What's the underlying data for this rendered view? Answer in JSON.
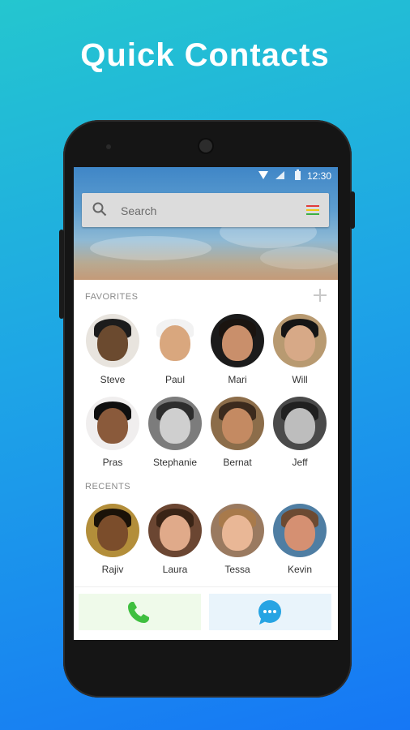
{
  "headline": "Quick Contacts",
  "status": {
    "time": "12:30"
  },
  "search": {
    "placeholder": "Search"
  },
  "favorites": {
    "label": "FAVORITES",
    "contacts": [
      {
        "name": "Steve",
        "skin": "#6b4a2f",
        "hair": "#1c1c1c",
        "bg": "#e8e4de"
      },
      {
        "name": "Paul",
        "skin": "#d9a77e",
        "hair": "#f2f2f2",
        "bg": "#ffffff"
      },
      {
        "name": "Mari",
        "skin": "#c98f6b",
        "hair": "#1a1410",
        "bg": "#1b1b1b"
      },
      {
        "name": "Will",
        "skin": "#d7a987",
        "hair": "#151515",
        "bg": "#b89a71"
      },
      {
        "name": "Pras",
        "skin": "#8a5a3b",
        "hair": "#0f0f0f",
        "bg": "#f0eeee"
      },
      {
        "name": "Stephanie",
        "skin": "#cfcfcf",
        "hair": "#2d2d2d",
        "bg": "#7c7c7c"
      },
      {
        "name": "Bernat",
        "skin": "#c48a62",
        "hair": "#3b2a1d",
        "bg": "#8c6d4a"
      },
      {
        "name": "Jeff",
        "skin": "#bdbdbd",
        "hair": "#202020",
        "bg": "#4a4a4a"
      }
    ]
  },
  "recents": {
    "label": "RECENTS",
    "contacts": [
      {
        "name": "Rajiv",
        "skin": "#7b4d2b",
        "hair": "#1a1208",
        "bg": "#b38e3a"
      },
      {
        "name": "Laura",
        "skin": "#e0aa8a",
        "hair": "#3a2416",
        "bg": "#6b4632"
      },
      {
        "name": "Tessa",
        "skin": "#e9b796",
        "hair": "#a87a4b",
        "bg": "#9a7a60"
      },
      {
        "name": "Kevin",
        "skin": "#d59072",
        "hair": "#6c4a32",
        "bg": "#4f7ea3"
      }
    ]
  },
  "colors": {
    "accent_green": "#3fbf3f",
    "accent_blue": "#27a4e3",
    "menu_stripes": [
      "#e23b3b",
      "#f2c40f",
      "#3cb043"
    ]
  },
  "icons": {
    "search": "search-icon",
    "menu": "menu-icon",
    "add": "add-icon",
    "call": "phone-icon",
    "message": "chat-bubble-icon"
  }
}
